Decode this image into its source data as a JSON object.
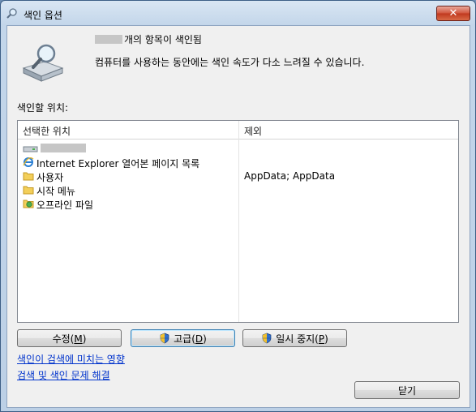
{
  "window": {
    "title": "색인 옵션",
    "close_glyph": "✕"
  },
  "header": {
    "count_suffix": "개의 항목이 색인됨",
    "notice": "컴퓨터를 사용하는 동안에는 색인 속도가 다소 느려질 수 있습니다."
  },
  "locations_label": "색인할 위치:",
  "list": {
    "col_selected": "선택한 위치",
    "col_exclude": "제외",
    "rows": [
      {
        "label": "",
        "icon": "drive-icon",
        "exclude": ""
      },
      {
        "label": "Internet Explorer 열어본 페이지 목록",
        "icon": "internet-explorer-icon",
        "exclude": ""
      },
      {
        "label": "사용자",
        "icon": "folder-icon",
        "exclude": "AppData; AppData"
      },
      {
        "label": "시작 메뉴",
        "icon": "folder-icon",
        "exclude": ""
      },
      {
        "label": "오프라인 파일",
        "icon": "offline-files-icon",
        "exclude": ""
      }
    ]
  },
  "buttons": {
    "modify_text": "수정(",
    "modify_key": "M",
    "modify_end": ")",
    "advanced_text": "고급(",
    "advanced_key": "D",
    "advanced_end": ")",
    "pause_text": "일시 중지(",
    "pause_key": "P",
    "pause_end": ")",
    "close_label": "닫기"
  },
  "links": {
    "affect_search": "색인이 검색에 미치는 영향",
    "troubleshoot": "검색 및 색인 문제 해결"
  }
}
